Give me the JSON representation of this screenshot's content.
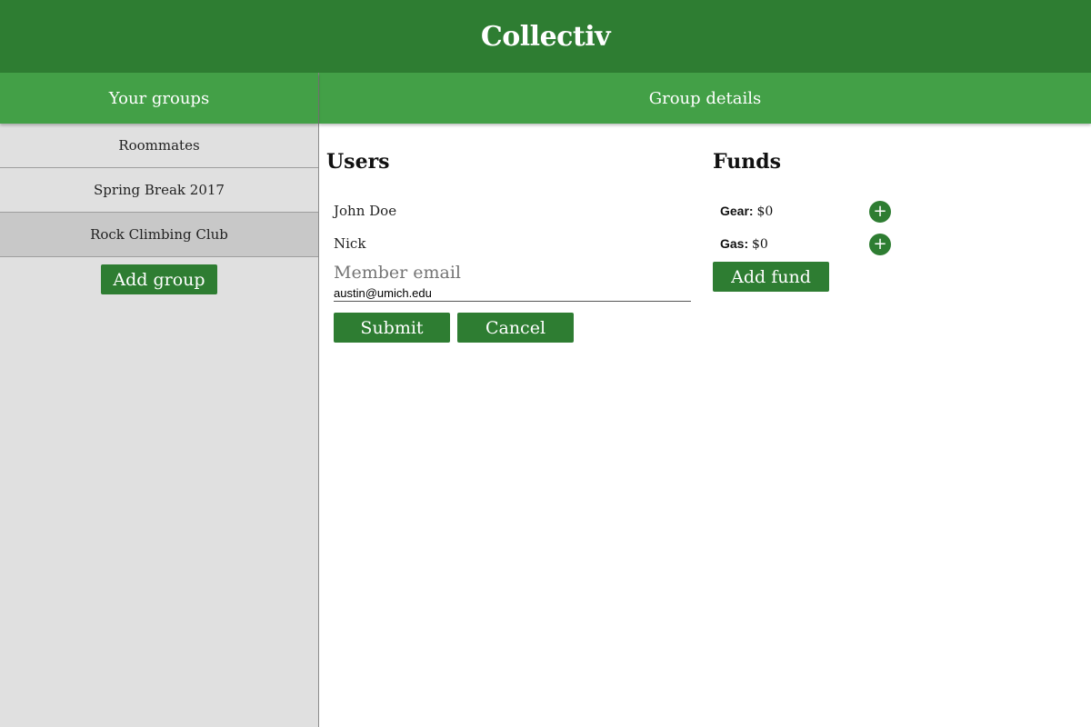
{
  "app": {
    "title": "Collectiv"
  },
  "sidebar": {
    "header": "Your groups",
    "groups": [
      {
        "label": "Roommates"
      },
      {
        "label": "Spring Break 2017"
      },
      {
        "label": "Rock Climbing Club"
      }
    ],
    "add_group_label": "Add group"
  },
  "main": {
    "header": "Group details",
    "users": {
      "title": "Users",
      "list": [
        {
          "name": "John Doe"
        },
        {
          "name": "Nick"
        }
      ],
      "form": {
        "label": "Member email",
        "value": "austin@umich.edu",
        "submit_label": "Submit",
        "cancel_label": "Cancel"
      }
    },
    "funds": {
      "title": "Funds",
      "list": [
        {
          "name": "Gear:",
          "amount": "$0",
          "add_icon": "+"
        },
        {
          "name": "Gas:",
          "amount": "$0",
          "add_icon": "+"
        }
      ],
      "add_fund_label": "Add fund"
    }
  },
  "colors": {
    "primary": "#2e7d32",
    "secondary": "#43a047",
    "sidebar_bg": "#e0e0e0",
    "active_item_bg": "#c8c8c8"
  }
}
